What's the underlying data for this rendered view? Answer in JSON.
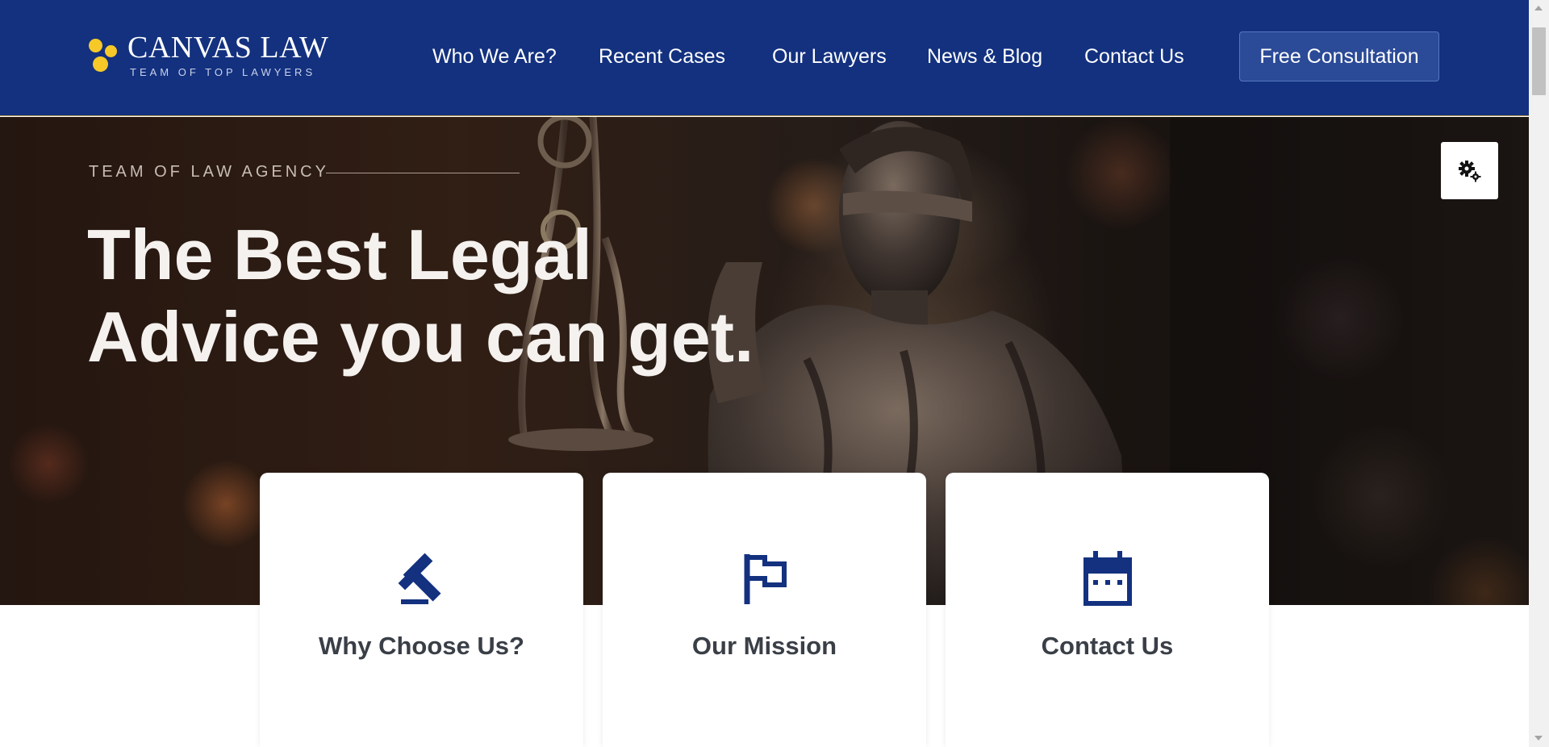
{
  "brand": {
    "name": "CANVAS LAW",
    "tagline": "TEAM OF TOP LAWYERS",
    "accent_color": "#f6c928"
  },
  "nav": {
    "items": [
      "Who We Are?",
      "Recent Cases",
      "Our Lawyers",
      "News & Blog",
      "Contact Us"
    ],
    "cta_label": "Free Consultation",
    "background_color": "#13317f"
  },
  "hero": {
    "eyebrow": "TEAM OF LAW AGENCY",
    "headline_line1": "The Best Legal",
    "headline_line2": "Advice you can get.",
    "settings_icon": "gears-icon"
  },
  "features": [
    {
      "label": "Why Choose Us?",
      "icon": "gavel-icon"
    },
    {
      "label": "Our Mission",
      "icon": "flag-icon"
    },
    {
      "label": "Contact Us",
      "icon": "calendar-icon"
    }
  ],
  "colors": {
    "icon_blue": "#13317f",
    "card_text": "#3a3f47"
  }
}
